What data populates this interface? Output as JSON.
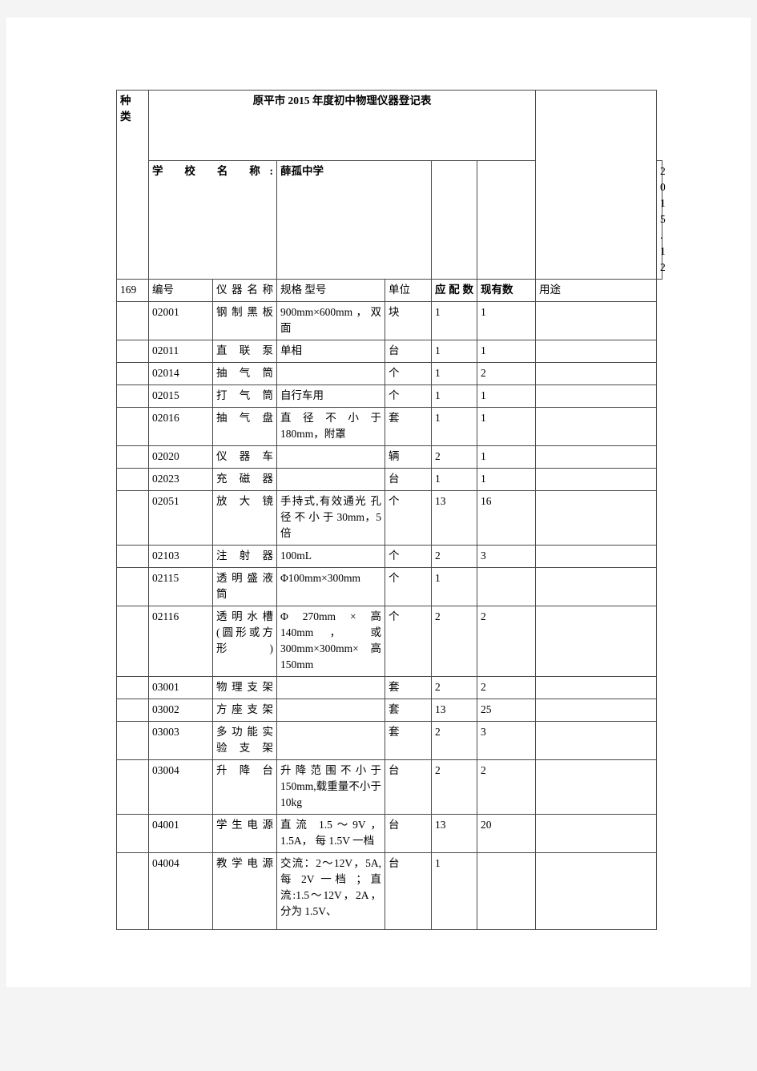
{
  "document": {
    "title": "原平市 2015 年度初中物理仪器登记表",
    "kind_label_chars": [
      "种",
      "类"
    ],
    "kind_value": "169",
    "school_label": "学 校 名 称:",
    "school_name": "薛孤中学",
    "date": "2015.12"
  },
  "table": {
    "headers": {
      "code": "编号",
      "name": "仪 器 名 称",
      "spec": "规格  型号",
      "unit": "单位",
      "required": "应 配 数",
      "current": "现有数",
      "usage": "用途"
    },
    "rows": [
      {
        "code": "02001",
        "name": "钢 制 黑 板",
        "spec": "900mm×600mm，双面",
        "unit": "块",
        "required": "1",
        "current": "1",
        "usage": ""
      },
      {
        "code": "02011",
        "name": "直联泵",
        "spec": "单相",
        "unit": "台",
        "required": "1",
        "current": "1",
        "usage": ""
      },
      {
        "code": "02014",
        "name": "抽气筒",
        "spec": "",
        "unit": "个",
        "required": "1",
        "current": "2",
        "usage": ""
      },
      {
        "code": "02015",
        "name": "打气筒",
        "spec": "自行车用",
        "unit": "个",
        "required": "1",
        "current": "1",
        "usage": ""
      },
      {
        "code": "02016",
        "name": "抽气盘",
        "spec": "直 径 不 小 于 180mm，附罩",
        "unit": "套",
        "required": "1",
        "current": "1",
        "usage": ""
      },
      {
        "code": "02020",
        "name": "仪器车",
        "spec": "",
        "unit": "辆",
        "required": "2",
        "current": "1",
        "usage": ""
      },
      {
        "code": "02023",
        "name": "充磁器",
        "spec": "",
        "unit": "台",
        "required": "1",
        "current": "1",
        "usage": ""
      },
      {
        "code": "02051",
        "name": "放大镜",
        "spec": "手持式,有效通光 孔 径 不 小 于 30mm，5 倍",
        "unit": "个",
        "required": "13",
        "current": "16",
        "usage": ""
      },
      {
        "code": "02103",
        "name": "注射器",
        "spec": "100mL",
        "unit": "个",
        "required": "2",
        "current": "3",
        "usage": ""
      },
      {
        "code": "02115",
        "name": "透 明 盛 液筒",
        "spec": "Φ100mm×300mm",
        "unit": "个",
        "required": "1",
        "current": "",
        "usage": ""
      },
      {
        "code": "02116",
        "name": "透 明 水 槽(圆形或方形)",
        "spec": "Φ 270mm × 高 140mm ，  或 300mm×300mm×高 150mm",
        "unit": "个",
        "required": "2",
        "current": "2",
        "usage": ""
      },
      {
        "code": "03001",
        "name": "物 理 支 架",
        "spec": "",
        "unit": "套",
        "required": "2",
        "current": "2",
        "usage": ""
      },
      {
        "code": "03002",
        "name": "方 座 支 架",
        "spec": "",
        "unit": "套",
        "required": "13",
        "current": "25",
        "usage": ""
      },
      {
        "code": "03003",
        "name": "多 功 能 实 验 支 架",
        "spec": "",
        "unit": "套",
        "required": "2",
        "current": "3",
        "usage": ""
      },
      {
        "code": "03004",
        "name": "升降台",
        "spec": "升降范围不小于 150mm,载重量不小于 10kg",
        "unit": "台",
        "required": "2",
        "current": "2",
        "usage": ""
      },
      {
        "code": "04001",
        "name": "学 生 电 源",
        "spec": "直流 1.5～9V，1.5A， 每 1.5V 一档",
        "unit": "台",
        "required": "13",
        "current": "20",
        "usage": ""
      },
      {
        "code": "04004",
        "name": "教 学 电 源",
        "spec": "交流：2～12V，5A,每 2V 一档 ；直流:1.5～12V，2A，分为 1.5V、",
        "unit": "台",
        "required": "1",
        "current": "",
        "usage": ""
      }
    ]
  }
}
